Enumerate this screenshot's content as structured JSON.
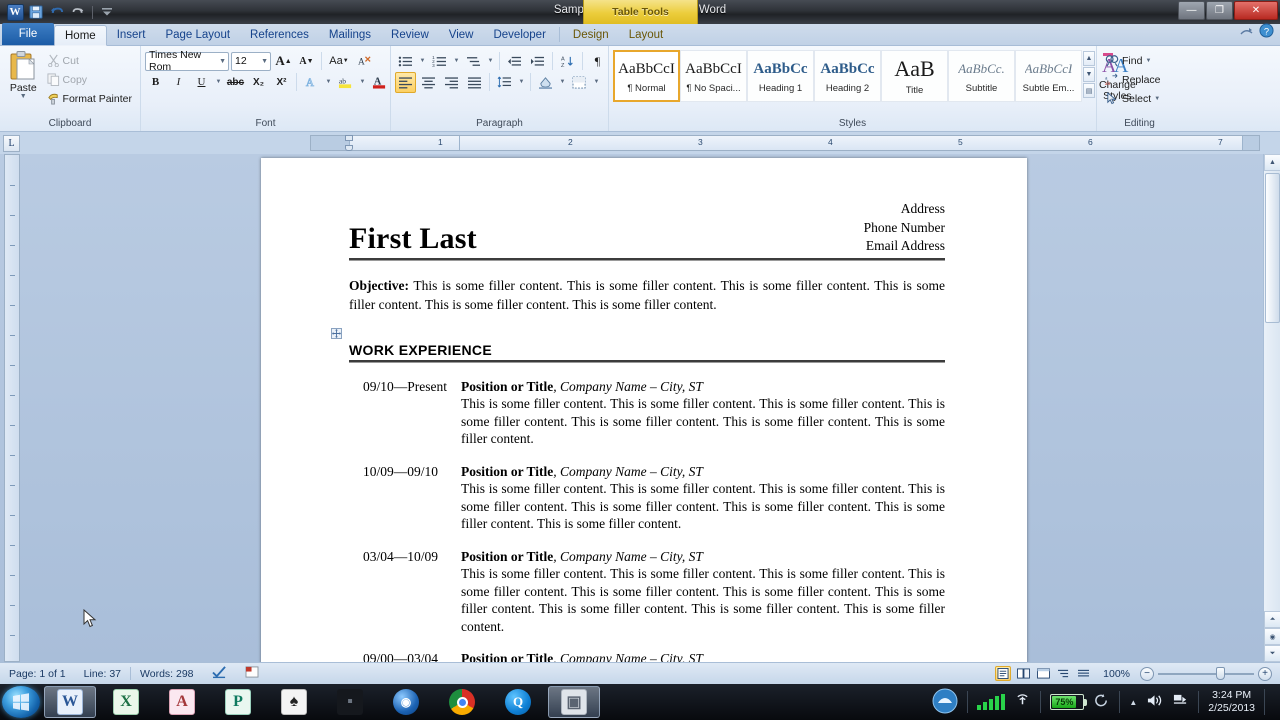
{
  "window": {
    "title": "Sample Resume - Microsoft Word",
    "app_icon": "word-icon",
    "minimize": "—",
    "restore": "❐",
    "close": "✕",
    "help": "?",
    "collapse_ribbon": "collapse-ribbon-icon"
  },
  "quick_access": {
    "save": "save-icon",
    "undo": "undo-icon",
    "redo": "redo-icon",
    "customize": "customize-icon"
  },
  "contextual": {
    "label": "Table Tools"
  },
  "tabs": {
    "file": "File",
    "items": [
      "Home",
      "Insert",
      "Page Layout",
      "References",
      "Mailings",
      "Review",
      "View",
      "Developer"
    ],
    "active": "Home",
    "contextual_items": [
      "Design",
      "Layout"
    ]
  },
  "ribbon": {
    "clipboard": {
      "label": "Clipboard",
      "paste": "Paste",
      "cut": "Cut",
      "copy": "Copy",
      "format_painter": "Format Painter",
      "dialog_launcher": "dialog-launcher-icon"
    },
    "font": {
      "label": "Font",
      "font_name": "Times New Rom",
      "font_size": "12",
      "grow_font": "A",
      "shrink_font": "A",
      "change_case": "Aa",
      "clear_formatting": "clear-formatting-icon",
      "bold": "B",
      "italic": "I",
      "underline": "U",
      "strikethrough": "abc",
      "subscript": "X₂",
      "superscript": "X²",
      "text_effects": "A",
      "highlight": "ab",
      "font_color": "A",
      "dialog_launcher": "dialog-launcher-icon"
    },
    "paragraph": {
      "label": "Paragraph",
      "bullets": "bullets-icon",
      "numbering": "numbering-icon",
      "multilevel": "multilevel-list-icon",
      "decrease_indent": "decrease-indent-icon",
      "increase_indent": "increase-indent-icon",
      "sort": "sort-icon",
      "show_marks": "¶",
      "align_left": "align-left-icon",
      "align_center": "align-center-icon",
      "align_right": "align-right-icon",
      "justify": "justify-icon",
      "line_spacing": "line-spacing-icon",
      "shading": "shading-icon",
      "borders": "borders-icon",
      "dialog_launcher": "dialog-launcher-icon"
    },
    "styles": {
      "label": "Styles",
      "items": [
        {
          "preview": "AaBbCcI",
          "name": "¶ Normal",
          "selected": true,
          "kind": "normal"
        },
        {
          "preview": "AaBbCcI",
          "name": "¶ No Spaci...",
          "selected": false,
          "kind": "normal"
        },
        {
          "preview": "AaBbCс",
          "name": "Heading 1",
          "selected": false,
          "kind": "heading"
        },
        {
          "preview": "AaBbCc",
          "name": "Heading 2",
          "selected": false,
          "kind": "heading"
        },
        {
          "preview": "AaB",
          "name": "Title",
          "selected": false,
          "kind": "title"
        },
        {
          "preview": "AaBbCc.",
          "name": "Subtitle",
          "selected": false,
          "kind": "sub"
        },
        {
          "preview": "AaBbCcI",
          "name": "Subtle Em...",
          "selected": false,
          "kind": "sub"
        }
      ],
      "change_styles": "Change Styles",
      "scroll_up": "▲",
      "scroll_down": "▼",
      "more": "▤",
      "dialog_launcher": "dialog-launcher-icon"
    },
    "editing": {
      "label": "Editing",
      "find": "Find",
      "replace": "Replace",
      "select": "Select"
    }
  },
  "ruler": {
    "tab_selector": "L",
    "marks": [
      "1",
      "2",
      "3",
      "4",
      "5",
      "6",
      "7"
    ]
  },
  "document": {
    "name": "First Last",
    "contact": [
      "Address",
      "Phone Number",
      "Email Address"
    ],
    "objective_label": "Objective:",
    "objective_text": "This is some filler content. This is some filler content. This is some filler content. This is some filler content. This is some filler content. This is some filler content.",
    "section_title": "WORK EXPERIENCE",
    "table_move_handle": "table-move-handle-icon",
    "jobs": [
      {
        "date": "09/10—Present",
        "title": "Position or Title",
        "company": ", Company Name – City, ST",
        "description": "This is some filler content. This is some filler content. This is some filler content. This is some filler content. This is some filler content. This is some filler content. This is some filler content."
      },
      {
        "date": "10/09—09/10",
        "title": "Position or Title",
        "company": ", Company Name – City, ST",
        "description": "This is some filler content. This is some filler content. This is some filler content. This is some filler content. This is some filler content. This is some filler content. This is some filler content. This is some filler content."
      },
      {
        "date": "03/04—10/09",
        "title": "Position or Title",
        "company": ", Company Name – City, ST",
        "description": "This is some filler content. This is some filler content. This is some filler content. This is some filler content. This is some filler content. This is some filler content. This is some filler content. This is some filler content. This is some filler content. This is some filler content."
      },
      {
        "date": "09/00—03/04",
        "title": "Position or Title",
        "company": ", Company Name – City, ST",
        "description": ""
      }
    ]
  },
  "status_bar": {
    "page": "Page: 1 of 1",
    "line": "Line: 37",
    "words": "Words: 298",
    "proofing": "proofing-icon",
    "language": "language-icon",
    "views": [
      "print-layout-icon",
      "full-screen-reading-icon",
      "web-layout-icon",
      "outline-icon",
      "draft-icon"
    ],
    "active_view": "print-layout-icon",
    "zoom": "100%",
    "zoom_out": "−",
    "zoom_in": "+"
  },
  "taskbar": {
    "start": "start-orb-icon",
    "items": [
      {
        "name": "word-taskbar-icon",
        "glyph": "W",
        "color": "#e8f0fb",
        "fg": "#2b5797",
        "active": true
      },
      {
        "name": "excel-taskbar-icon",
        "glyph": "X",
        "color": "#eaf7ea",
        "fg": "#1e7145",
        "active": false
      },
      {
        "name": "access-taskbar-icon",
        "glyph": "A",
        "color": "#fbe8f0",
        "fg": "#a4373a",
        "active": false
      },
      {
        "name": "publisher-taskbar-icon",
        "glyph": "P",
        "color": "#e9f7f0",
        "fg": "#0e7a5f",
        "active": false
      },
      {
        "name": "solitaire-taskbar-icon",
        "glyph": "♠",
        "color": "#f4f4f4",
        "fg": "#222222",
        "active": false
      },
      {
        "name": "dark-app-taskbar-icon",
        "glyph": "",
        "color": "#15181d",
        "fg": "#6b7480",
        "active": false
      },
      {
        "name": "google-earth-taskbar-icon",
        "glyph": "◉",
        "color": "#0f4f9e",
        "fg": "#cfe6ff",
        "active": false
      },
      {
        "name": "chrome-taskbar-icon",
        "glyph": "◍",
        "color": "#f2f2f2",
        "fg": "#d93025",
        "active": false
      },
      {
        "name": "quicktime-taskbar-icon",
        "glyph": "Q",
        "color": "#0e7fd4",
        "fg": "#ffffff",
        "active": false
      },
      {
        "name": "media-window-taskbar-icon",
        "glyph": "▣",
        "color": "#dfe4ea",
        "fg": "#5a6472",
        "active": true
      }
    ],
    "tray": {
      "show_hidden": "▲",
      "network_icon": "wifi-icon",
      "signal_icon": "signal-bars-icon",
      "battery_percent": "75%",
      "battery_icon": "battery-icon",
      "sync_icon": "sync-icon",
      "volume_icon": "volume-icon",
      "action_icon": "action-center-icon",
      "time": "3:24 PM",
      "date": "2/25/2013"
    }
  },
  "colors": {
    "file_tab": "#1c5ca6",
    "contextual": "#eccd3c",
    "accent_selected": "#e8a72c",
    "battery_green": "#18a818"
  }
}
